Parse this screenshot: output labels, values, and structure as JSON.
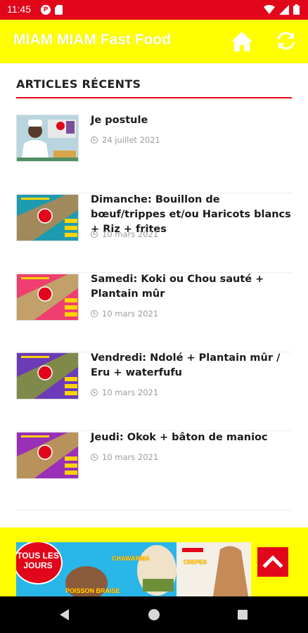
{
  "status_bar": {
    "time": "11:45",
    "notif_icon_1": "P"
  },
  "app_bar": {
    "title": "MIAM MIAM Fast Food"
  },
  "section": {
    "title": "ARTICLES RÉCENTS"
  },
  "articles": [
    {
      "title": "Je postule",
      "date": "24 juillet 2021"
    },
    {
      "title": "Dimanche: Bouillon de bœuf/trippes et/ou Haricots blancs + Riz + frites",
      "date": "10 mars 2021"
    },
    {
      "title": "Samedi: Koki ou Chou sauté + Plantain mûr",
      "date": "10 mars 2021"
    },
    {
      "title": "Vendredi: Ndolé + Plantain mûr / Eru + waterfufu",
      "date": "10 mars 2021"
    },
    {
      "title": "Jeudi: Okok + bâton de manioc",
      "date": "10 mars 2021"
    }
  ],
  "banner": {
    "line1": "TOUS LES",
    "line2": "JOURS",
    "chawarma": "CHAWARMA",
    "crepes": "CREPES",
    "poisson": "POISSON BRAISE"
  },
  "colors": {
    "accent": "#e1061a",
    "brand_yellow": "#ffff00"
  }
}
